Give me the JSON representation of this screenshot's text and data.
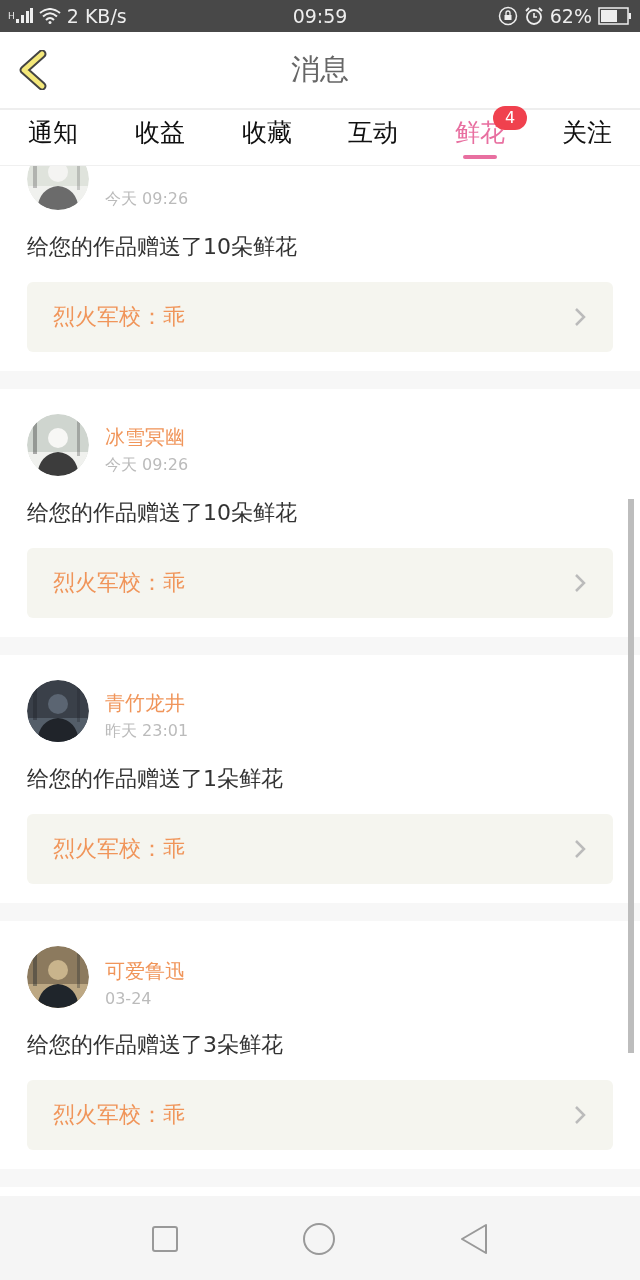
{
  "status_bar": {
    "network_type": "H",
    "speed": "2 KB/s",
    "time": "09:59",
    "battery": "62%"
  },
  "header": {
    "title": "消息"
  },
  "tabs": [
    {
      "label": "通知",
      "selected": false
    },
    {
      "label": "收益",
      "selected": false
    },
    {
      "label": "收藏",
      "selected": false
    },
    {
      "label": "互动",
      "selected": false
    },
    {
      "label": "鲜花",
      "selected": true,
      "badge": "4"
    },
    {
      "label": "关注",
      "selected": false
    }
  ],
  "messages": [
    {
      "time": "今天 09:26",
      "text": "给您的作品赠送了10朵鲜花",
      "work": "烈火军校：乖"
    },
    {
      "name": "冰雪冥幽",
      "time": "今天 09:26",
      "text": "给您的作品赠送了10朵鲜花",
      "work": "烈火军校：乖"
    },
    {
      "name": "青竹龙井",
      "time": "昨天 23:01",
      "text": "给您的作品赠送了1朵鲜花",
      "work": "烈火军校：乖"
    },
    {
      "name": "可爱鲁迅",
      "time": "03-24",
      "text": "给您的作品赠送了3朵鲜花",
      "work": "烈火军校：乖"
    }
  ]
}
